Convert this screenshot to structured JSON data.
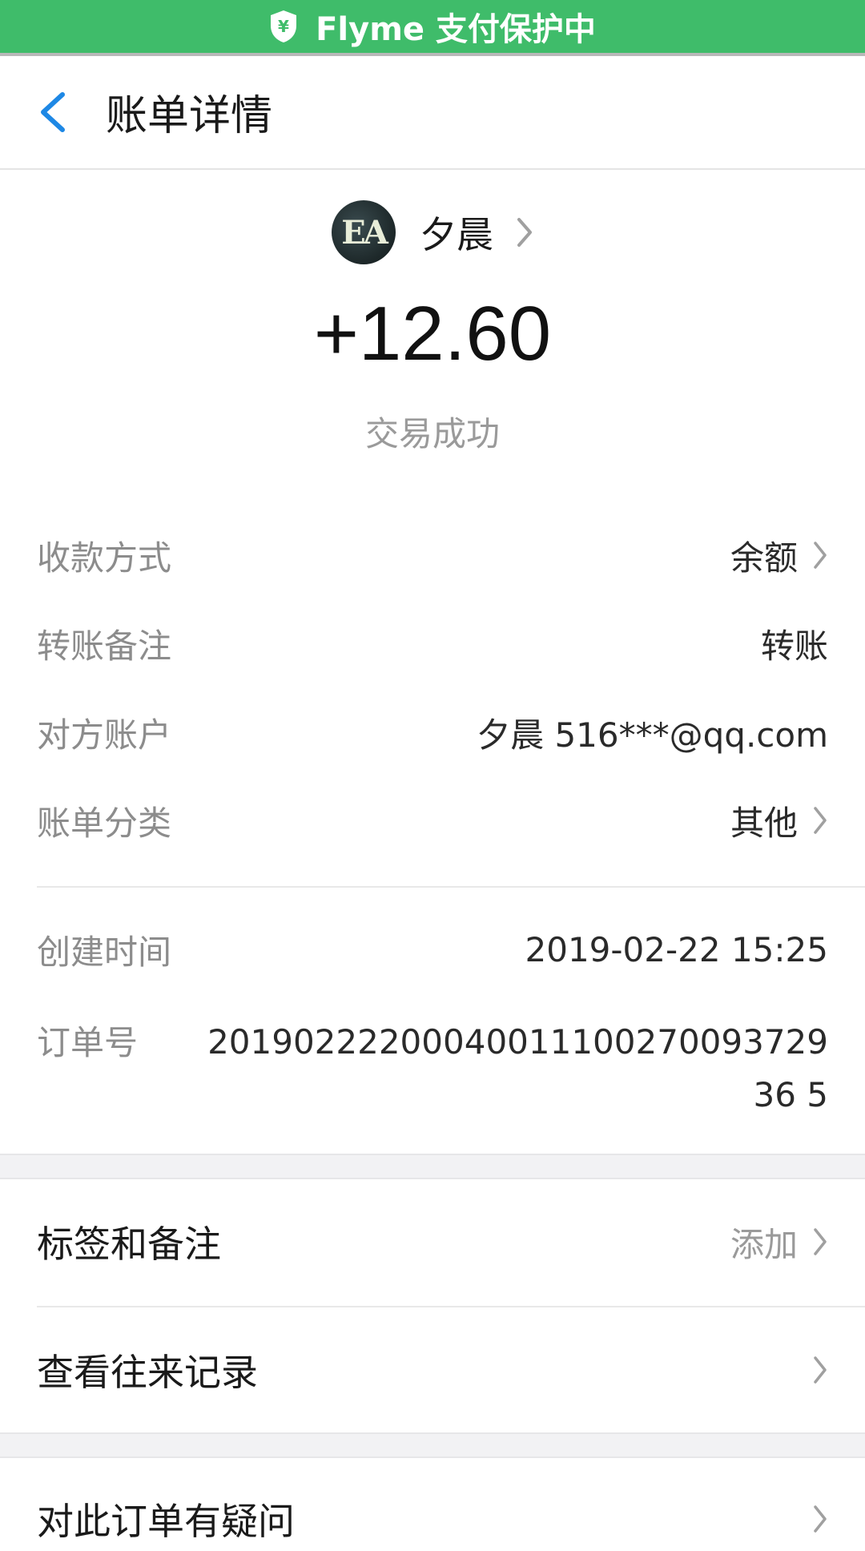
{
  "banner": {
    "text": "Flyme 支付保护中"
  },
  "header": {
    "title": "账单详情"
  },
  "payer": {
    "avatar_text": "EA",
    "name": "夕晨"
  },
  "transaction": {
    "amount": "+12.60",
    "status": "交易成功"
  },
  "details": [
    {
      "label": "收款方式",
      "value": "余额"
    },
    {
      "label": "转账备注",
      "value": "转账"
    },
    {
      "label": "对方账户",
      "value": "夕晨 516***@qq.com"
    },
    {
      "label": "账单分类",
      "value": "其他"
    }
  ],
  "meta": {
    "created_label": "创建时间",
    "created_value": "2019-02-22 15:25",
    "order_label": "订单号",
    "order_value": "2019022220004001110027009372936 5"
  },
  "actions": [
    {
      "label": "标签和备注",
      "value": "添加"
    },
    {
      "label": "查看往来记录",
      "value": ""
    },
    {
      "label": "对此订单有疑问",
      "value": ""
    }
  ],
  "colors": {
    "banner": "#3fbc6a",
    "accent": "#1e88e5"
  }
}
